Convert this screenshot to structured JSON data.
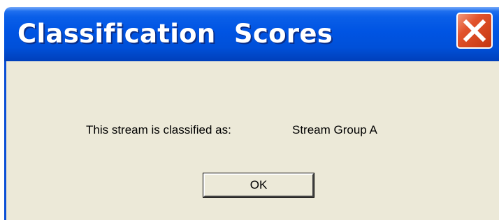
{
  "window": {
    "title": "Classification  Scores",
    "close_icon": "close-icon",
    "colors": {
      "titlebar": "#0054e3",
      "close_button": "#d2431d",
      "dialog_background": "#ece9d8"
    }
  },
  "message": {
    "label": "This stream is classified as:",
    "value": "Stream Group A"
  },
  "buttons": {
    "ok_label": "OK"
  }
}
